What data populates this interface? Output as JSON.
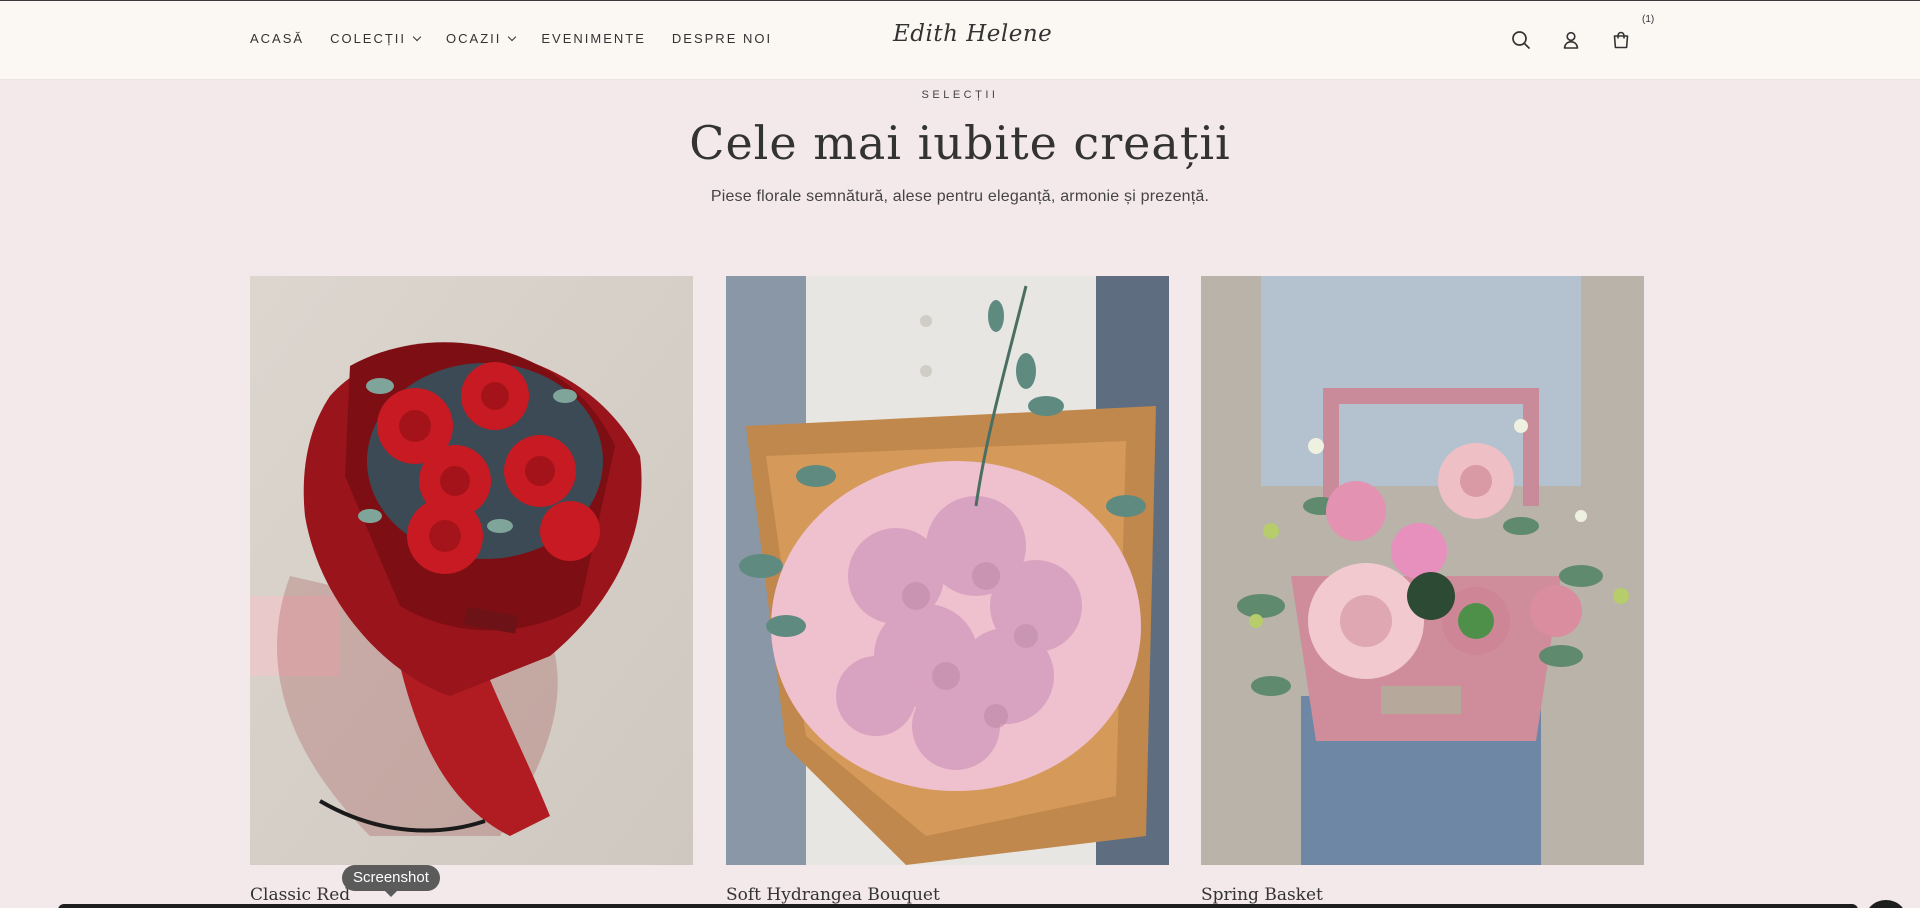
{
  "header": {
    "nav": [
      {
        "label": "ACASĂ",
        "dropdown": false
      },
      {
        "label": "COLECȚII",
        "dropdown": true
      },
      {
        "label": "OCAZII",
        "dropdown": true
      },
      {
        "label": "EVENIMENTE",
        "dropdown": false
      },
      {
        "label": "DESPRE NOI",
        "dropdown": false
      }
    ],
    "logo": "Edith Helene",
    "icons": [
      "search-icon",
      "account-icon",
      "cart-icon"
    ],
    "cart_count": "(1)"
  },
  "section": {
    "eyebrow": "SELECȚII",
    "title": "Cele mai iubite creații",
    "subtitle": "Piese florale semnătură, alese pentru eleganță, armonie și prezență."
  },
  "products": [
    {
      "name": "Classic Red"
    },
    {
      "name": "Soft Hydrangea Bouquet"
    },
    {
      "name": "Spring Basket"
    }
  ],
  "tooltip": "Screenshot",
  "colors": {
    "page_bg": "#f3e8ea",
    "header_bg": "#fbf8f4",
    "text": "#2b2b2b"
  }
}
